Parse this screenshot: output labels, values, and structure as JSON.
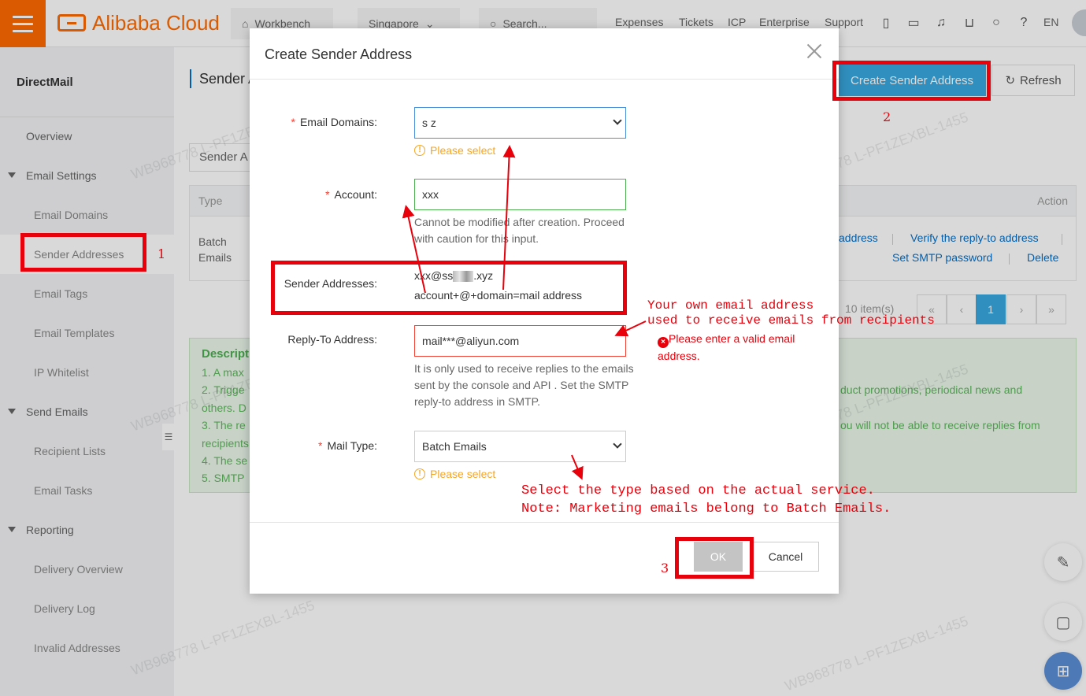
{
  "topbar": {
    "brand": "Alibaba Cloud",
    "workbench": "Workbench",
    "region": "Singapore",
    "search_placeholder": "Search...",
    "links": [
      "Expenses",
      "Tickets",
      "ICP",
      "Enterprise",
      "Support"
    ],
    "lang": "EN"
  },
  "sidebar": {
    "title": "DirectMail",
    "overview": "Overview",
    "email_settings": "Email Settings",
    "email_domains": "Email Domains",
    "sender_addresses": "Sender Addresses",
    "email_tags": "Email Tags",
    "email_templates": "Email Templates",
    "ip_whitelist": "IP Whitelist",
    "send_emails": "Send Emails",
    "recipient_lists": "Recipient Lists",
    "email_tasks": "Email Tasks",
    "reporting": "Reporting",
    "delivery_overview": "Delivery Overview",
    "delivery_log": "Delivery Log",
    "invalid_addresses": "Invalid Addresses"
  },
  "page": {
    "title": "Sender A",
    "create_btn": "Create Sender Address",
    "refresh_btn": "Refresh",
    "search_text": "Sender A",
    "col_type": "Type",
    "col_action": "Action",
    "row_type": "Batch Emails",
    "link_address": "address",
    "link_verify": "Verify the reply-to address",
    "link_smtp": "Set SMTP password",
    "link_delete": "Delete",
    "pager_info": "10 item(s)",
    "pager_current": "1",
    "desc_title": "Descript",
    "desc_lines": [
      "1. A max",
      "2. Trigge",
      "others. D",
      "3. The re",
      "recipients",
      "4. The se",
      "5. SMTP"
    ],
    "desc_right_1": "duct promotions, periodical news and",
    "desc_right_2": "ou will not be able to receive replies from"
  },
  "modal": {
    "title": "Create Sender Address",
    "label_domains": "Email Domains:",
    "domain_value": "s         z",
    "please_select": "Please select",
    "label_account": "Account:",
    "account_value": "xxx",
    "account_help": "Cannot be modified after creation. Proceed with caution for this input.",
    "label_sender": "Sender Addresses:",
    "sender_prefix": "xxx@ss",
    "sender_suffix": ".xyz",
    "sender_formula": "account+@+domain=mail address",
    "label_reply": "Reply-To Address:",
    "reply_value": "mail***@aliyun.com",
    "reply_help": "It is only used to receive replies to the emails sent by the console and API . Set the SMTP reply-to address in SMTP.",
    "label_type": "Mail Type:",
    "type_value": "Batch Emails",
    "ok": "OK",
    "cancel": "Cancel"
  },
  "annotations": {
    "n1": "1",
    "n2": "2",
    "n3": "3",
    "own_email_1": "Your own email address",
    "own_email_2": "used to receive emails from recipients",
    "invalid_email": "Please enter a valid email address.",
    "type_note_1": "Select the type based on the actual service.",
    "type_note_2": "Note: Marketing emails belong to Batch Emails."
  },
  "watermark": "WB968778 L-PF1ZEXBL-1455",
  "colors": {
    "brand": "#ff6a00",
    "primary": "#39a9e0",
    "annotation": "#e8000b",
    "warning": "#f5a623"
  }
}
